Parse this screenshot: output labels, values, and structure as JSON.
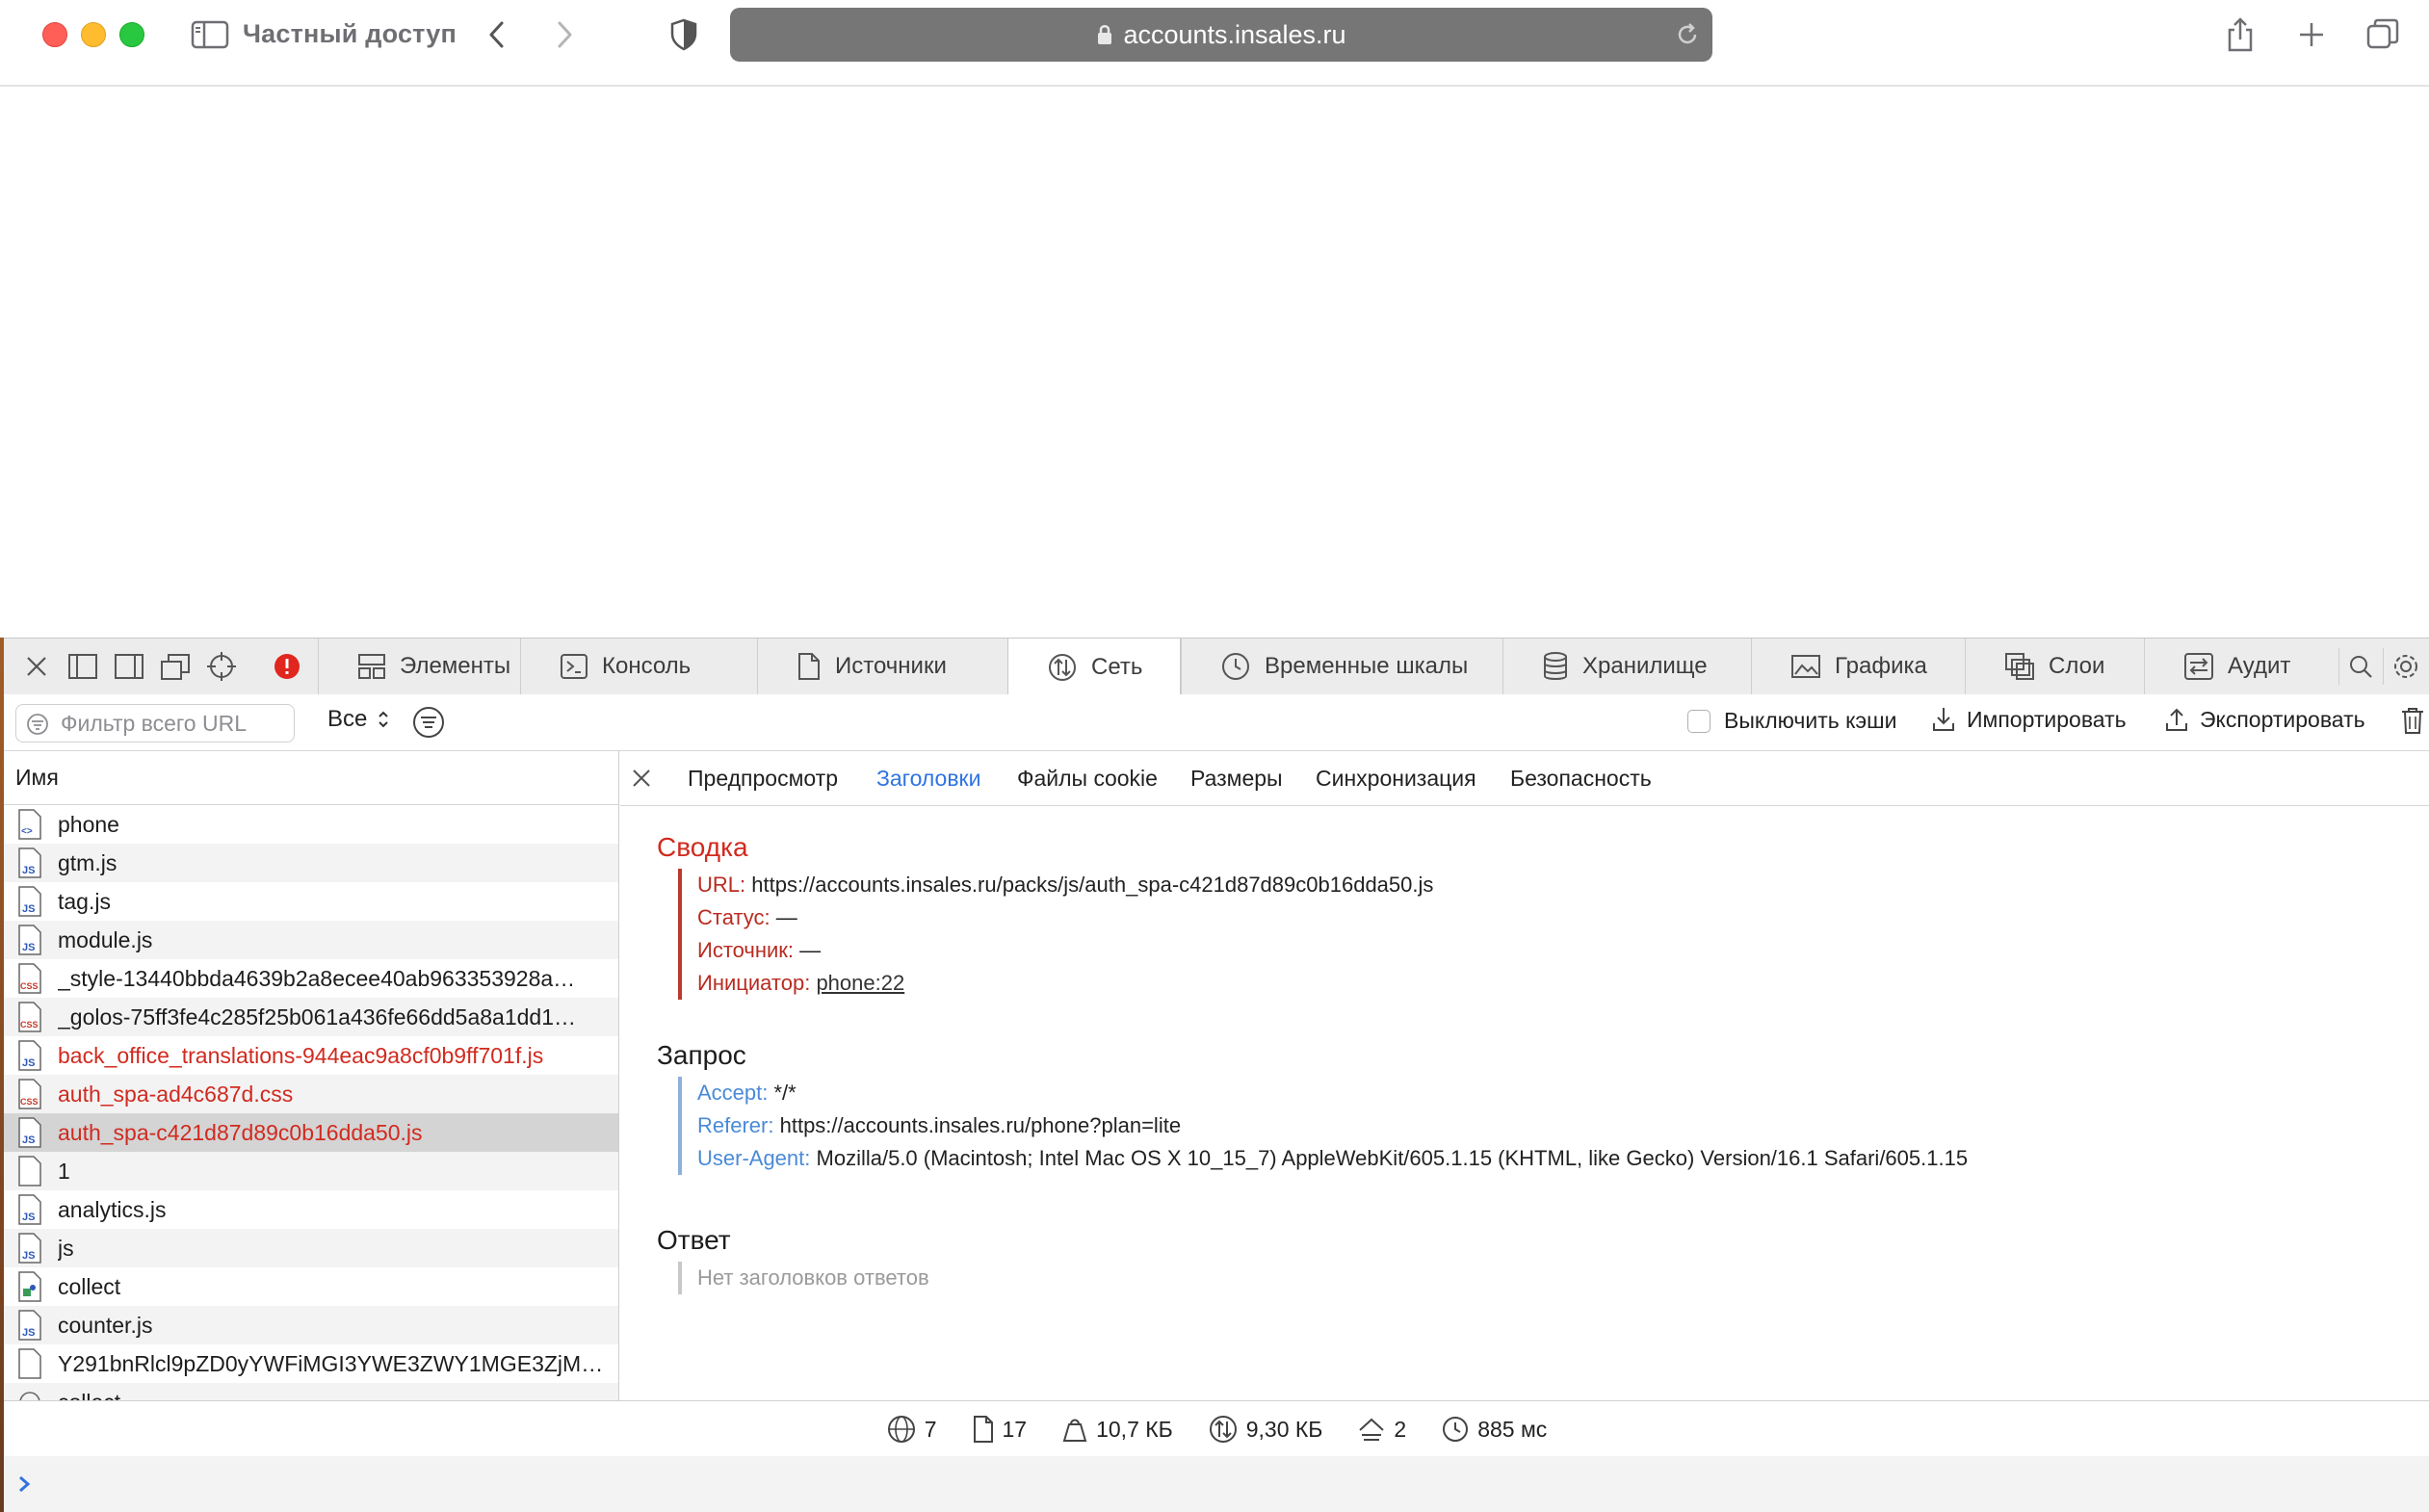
{
  "browser": {
    "private_label": "Частный доступ",
    "address": "accounts.insales.ru"
  },
  "devtools": {
    "tabs": [
      {
        "label": "Элементы",
        "icon": "elements-icon"
      },
      {
        "label": "Консоль",
        "icon": "console-icon"
      },
      {
        "label": "Источники",
        "icon": "sources-icon"
      },
      {
        "label": "Сеть",
        "icon": "network-icon",
        "active": true
      },
      {
        "label": "Временные шкалы",
        "icon": "timelines-icon"
      },
      {
        "label": "Хранилище",
        "icon": "storage-icon"
      },
      {
        "label": "Графика",
        "icon": "graphics-icon"
      },
      {
        "label": "Слои",
        "icon": "layers-icon"
      },
      {
        "label": "Аудит",
        "icon": "audit-icon"
      }
    ],
    "filter": {
      "placeholder": "Фильтр всего URL",
      "type_value": "Все",
      "disable_cache": "Выключить кэши",
      "import": "Импортировать",
      "export": "Экспортировать"
    },
    "list": {
      "header": "Имя",
      "rows": [
        {
          "name": "phone",
          "type": "html"
        },
        {
          "name": "gtm.js",
          "type": "js"
        },
        {
          "name": "tag.js",
          "type": "js"
        },
        {
          "name": "module.js",
          "type": "js"
        },
        {
          "name": "_style-13440bbda4639b2a8ecee40ab963353928a…",
          "type": "css"
        },
        {
          "name": "_golos-75ff3fe4c285f25b061a436fe66dd5a8a1dd1…",
          "type": "css"
        },
        {
          "name": "back_office_translations-944eac9a8cf0b9ff701f.js",
          "type": "js",
          "error": true
        },
        {
          "name": "auth_spa-ad4c687d.css",
          "type": "css",
          "error": true
        },
        {
          "name": "auth_spa-c421d87d89c0b16dda50.js",
          "type": "js",
          "error": true,
          "selected": true
        },
        {
          "name": "1",
          "type": "doc"
        },
        {
          "name": "analytics.js",
          "type": "js"
        },
        {
          "name": "js",
          "type": "js"
        },
        {
          "name": "collect",
          "type": "img"
        },
        {
          "name": "counter.js",
          "type": "js"
        },
        {
          "name": "Y291bnRlcl9pZD0yYWFiMGI3YWE3ZWY1MGE3ZjMy…",
          "type": "doc"
        },
        {
          "name": "collect",
          "type": "other"
        }
      ]
    },
    "detail_tabs": [
      "Предпросмотр",
      "Заголовки",
      "Файлы cookie",
      "Размеры",
      "Синхронизация",
      "Безопасность"
    ],
    "active_detail_tab": "Заголовки",
    "summary": {
      "title": "Сводка",
      "url_key": "URL:",
      "url_val": "https://accounts.insales.ru/packs/js/auth_spa-c421d87d89c0b16dda50.js",
      "status_key": "Статус:",
      "status_val": "—",
      "source_key": "Источник:",
      "source_val": "—",
      "initiator_key": "Инициатор:",
      "initiator_val": "phone:22"
    },
    "request": {
      "title": "Запрос",
      "accept_key": "Accept:",
      "accept_val": "*/*",
      "referer_key": "Referer:",
      "referer_val": "https://accounts.insales.ru/phone?plan=lite",
      "ua_key": "User-Agent:",
      "ua_val": "Mozilla/5.0 (Macintosh; Intel Mac OS X 10_15_7) AppleWebKit/605.1.15 (KHTML, like Gecko) Version/16.1 Safari/605.1.15"
    },
    "response": {
      "title": "Ответ",
      "empty": "Нет заголовков ответов"
    },
    "status": {
      "resources": "7",
      "documents": "17",
      "transferred": "10,7 КБ",
      "size": "9,30 КБ",
      "redirects": "2",
      "time": "885 мс"
    }
  },
  "colors": {
    "accent": "#2f74e0",
    "error": "#d12a1f",
    "address_bar": "#767676"
  }
}
